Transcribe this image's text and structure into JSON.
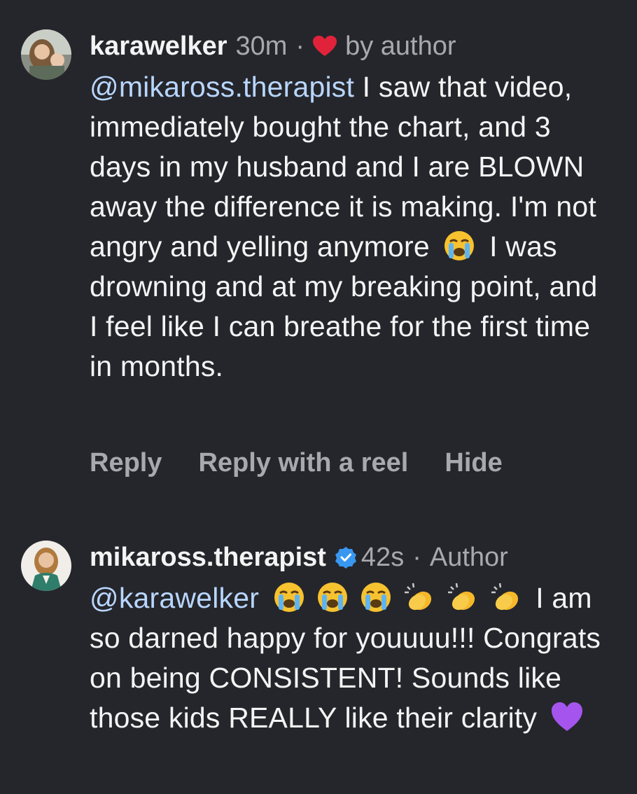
{
  "comment1": {
    "username": "karawelker",
    "time": "30m",
    "separator": "·",
    "liked_label": "by author",
    "mention": "@mikaross.therapist",
    "text_part1": " I saw that video, immediately bought the chart, and 3 days in my husband and I are BLOWN away the difference it is making. I'm not angry and yelling anymore ",
    "emoji_1": "loudly-crying-face",
    "text_part2": " I was drowning and at my breaking point, and I feel like I can breathe for the first time in months.",
    "actions": {
      "reply": "Reply",
      "reply_reel": "Reply with a reel",
      "hide": "Hide"
    }
  },
  "comment2": {
    "username": "mikaross.therapist",
    "time": "42s",
    "separator": "·",
    "role": "Author",
    "mention": "@karawelker",
    "emojis": [
      "loudly-crying-face",
      "loudly-crying-face",
      "loudly-crying-face",
      "clapping-hands",
      "clapping-hands",
      "clapping-hands"
    ],
    "text": " I am so darned happy for youuuu!!! Congrats on being CONSISTENT! Sounds like those kids REALLY like their clarity ",
    "emoji_end": "purple-heart"
  },
  "colors": {
    "background": "#25262b",
    "text": "#f4f4f5",
    "muted": "#a8a9ad",
    "mention": "#b8d6ff",
    "heart": "#e0233a",
    "verified": "#3897f0"
  }
}
